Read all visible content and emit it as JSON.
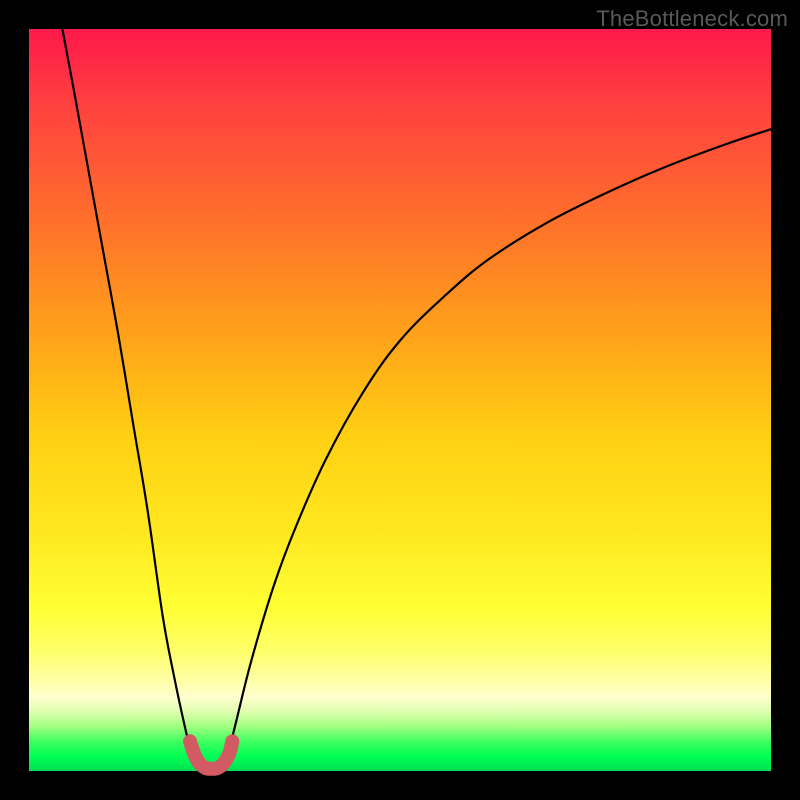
{
  "watermark": "TheBottleneck.com",
  "colors": {
    "frame": "#000000",
    "curve": "#000000",
    "marker": "#d15a63"
  },
  "chart_data": {
    "type": "line",
    "title": "",
    "xlabel": "",
    "ylabel": "",
    "xlim": [
      0,
      100
    ],
    "ylim": [
      0,
      100
    ],
    "series": [
      {
        "name": "left-branch",
        "x": [
          4.5,
          6,
          8,
          10,
          12,
          14,
          16,
          18,
          19.5,
          21,
          22,
          22.8
        ],
        "y": [
          100,
          92,
          81,
          70,
          59,
          47,
          35,
          21,
          13,
          6,
          2,
          0.5
        ]
      },
      {
        "name": "right-branch",
        "x": [
          26.2,
          27,
          28,
          30,
          33,
          36,
          40,
          45,
          50,
          56,
          62,
          70,
          78,
          86,
          94,
          100
        ],
        "y": [
          0.5,
          3,
          7,
          15,
          25,
          33,
          42,
          51,
          58,
          64,
          69,
          74,
          78,
          81.5,
          84.5,
          86.5
        ]
      },
      {
        "name": "bottom-u-marker",
        "x": [
          21.7,
          22.3,
          23.0,
          23.8,
          24.6,
          25.4,
          26.2,
          27.0,
          27.4
        ],
        "y": [
          4.0,
          2.2,
          1.0,
          0.4,
          0.3,
          0.4,
          1.0,
          2.4,
          4.0
        ]
      }
    ],
    "gradient_stops": [
      {
        "pos": 0,
        "color": "#ff1a4c"
      },
      {
        "pos": 24,
        "color": "#ff6a2d"
      },
      {
        "pos": 55,
        "color": "#ffd012"
      },
      {
        "pos": 78,
        "color": "#ffff34"
      },
      {
        "pos": 100,
        "color": "#00e050"
      }
    ]
  }
}
